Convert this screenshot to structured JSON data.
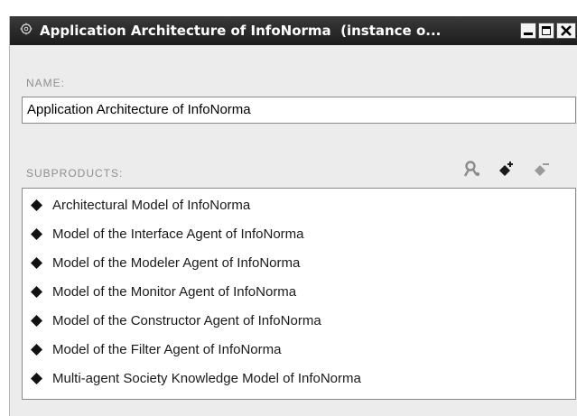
{
  "window": {
    "title": "Application Architecture of InfoNorma  (instance o...",
    "title_icon": "gear-icon",
    "controls": [
      "minimize-icon",
      "maximize-icon",
      "close-icon"
    ]
  },
  "name_section": {
    "label": "NAME:",
    "value": "Application Architecture of InfoNorma"
  },
  "subproducts": {
    "label": "SUBPRODUCTS:",
    "toolbar_icons": [
      "person-icon",
      "add-diamond-icon",
      "remove-diamond-icon"
    ],
    "item_icon": "diamond-icon",
    "items": [
      {
        "label": "Architectural Model of InfoNorma"
      },
      {
        "label": "Model of the Interface Agent of InfoNorma"
      },
      {
        "label": "Model of the Modeler Agent of InfoNorma"
      },
      {
        "label": "Model of the Monitor Agent of InfoNorma"
      },
      {
        "label": "Model of the Constructor Agent of InfoNorma"
      },
      {
        "label": "Model of the Filter Agent of InfoNorma"
      },
      {
        "label": "Multi-agent Society Knowledge Model of InfoNorma"
      }
    ]
  },
  "colors": {
    "titlebar": "#1c1c1c",
    "panel": "#ececec",
    "label_gray": "#8f8f8f",
    "icon_gray": "#8a8a8a"
  }
}
